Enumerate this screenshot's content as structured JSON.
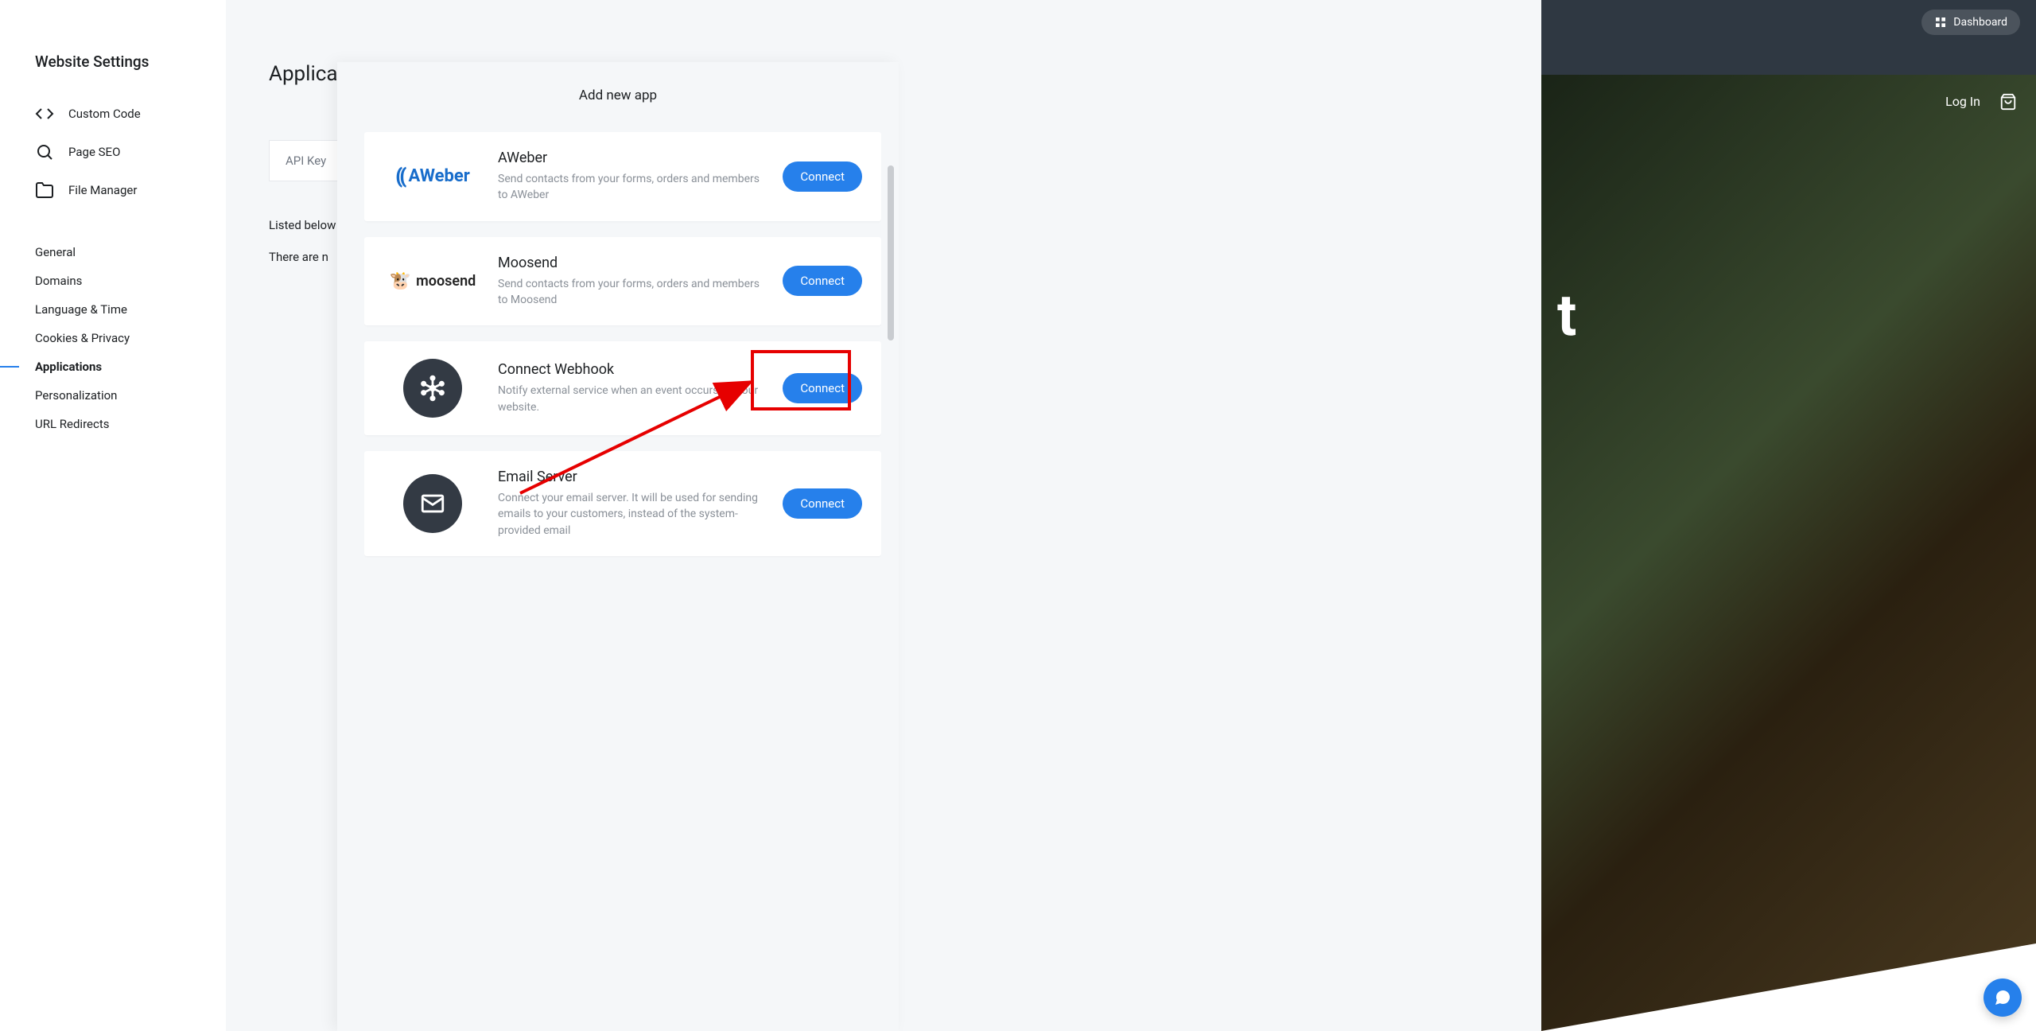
{
  "sidebar": {
    "title": "Website Settings",
    "icon_items": [
      {
        "label": "Custom Code"
      },
      {
        "label": "Page SEO"
      },
      {
        "label": "File Manager"
      }
    ],
    "nav_items": [
      {
        "label": "General",
        "active": false
      },
      {
        "label": "Domains",
        "active": false
      },
      {
        "label": "Language & Time",
        "active": false
      },
      {
        "label": "Cookies & Privacy",
        "active": false
      },
      {
        "label": "Applications",
        "active": true
      },
      {
        "label": "Personalization",
        "active": false
      },
      {
        "label": "URL Redirects",
        "active": false
      }
    ]
  },
  "main": {
    "title": "Applica",
    "api_key_label": "API Key",
    "desc1": "Listed below",
    "desc2": "There are n"
  },
  "modal": {
    "title": "Add new app",
    "connect_label": "Connect",
    "apps": [
      {
        "name": "AWeber",
        "desc": "Send contacts from your forms, orders and members to AWeber",
        "logo": "aweber"
      },
      {
        "name": "Moosend",
        "desc": "Send contacts from your forms, orders and members to Moosend",
        "logo": "moosend"
      },
      {
        "name": "Connect Webhook",
        "desc": "Notify external service when an event occurs on your website.",
        "logo": "webhook"
      },
      {
        "name": "Email Server",
        "desc": "Connect your email server. It will be used for sending emails to your customers, instead of the system-provided email",
        "logo": "email"
      }
    ]
  },
  "preview": {
    "dashboard_label": "Dashboard",
    "login_label": "Log In",
    "heading_fragment": "t"
  }
}
